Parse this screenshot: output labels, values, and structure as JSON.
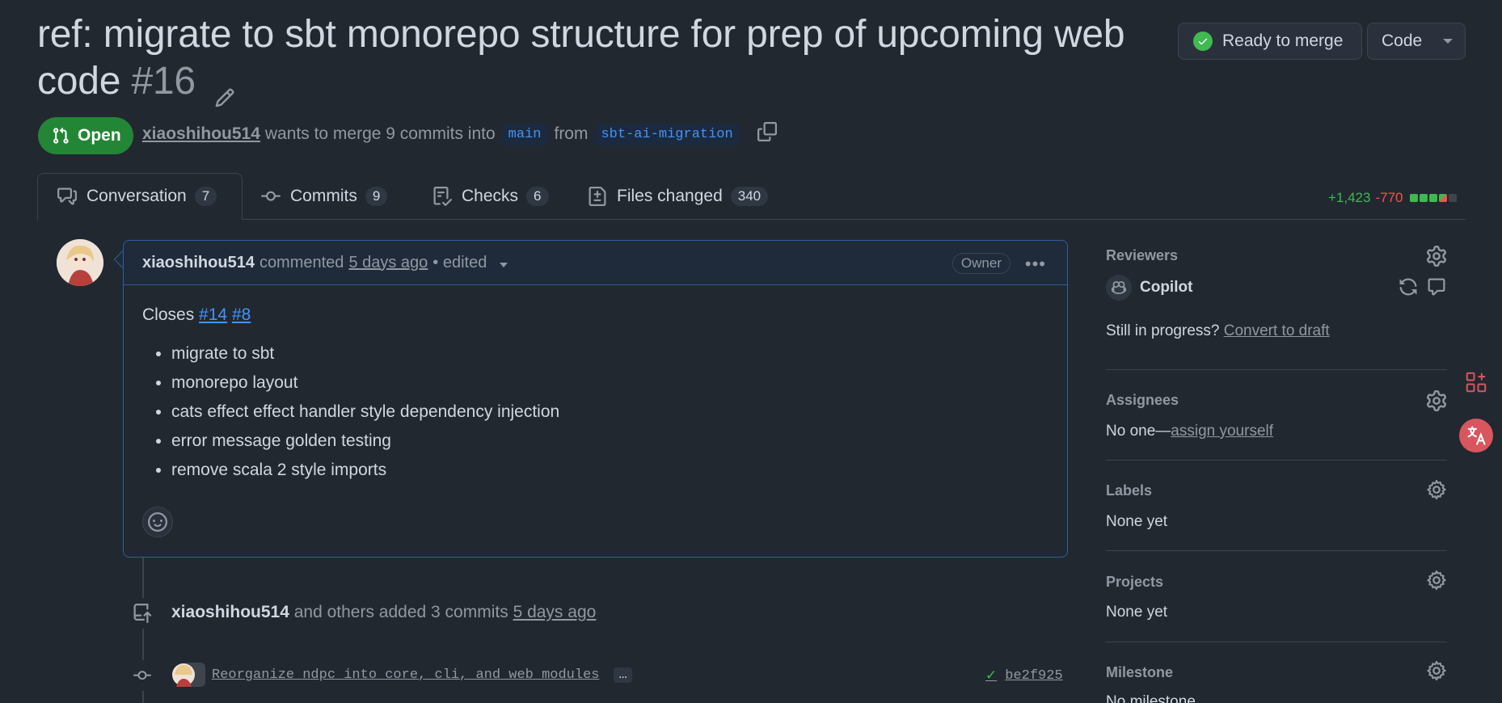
{
  "pr": {
    "title": "ref: migrate to sbt monorepo structure for prep of upcoming web code",
    "number": "#16",
    "status": "Open",
    "author": "xiaoshihou514",
    "merge_text": "wants to merge 9 commits into",
    "base_branch": "main",
    "from_text": "from",
    "head_branch": "sbt-ai-migration"
  },
  "header": {
    "ready_label": "Ready to merge",
    "code_label": "Code"
  },
  "tabs": [
    {
      "label": "Conversation",
      "count": "7"
    },
    {
      "label": "Commits",
      "count": "9"
    },
    {
      "label": "Checks",
      "count": "6"
    },
    {
      "label": "Files changed",
      "count": "340"
    }
  ],
  "diffstat": {
    "additions": "+1,423",
    "deletions": "-770"
  },
  "comment": {
    "author": "xiaoshihou514",
    "verb": "commented",
    "time": "5 days ago",
    "edited": "• edited",
    "role": "Owner",
    "closes_label": "Closes",
    "issues": [
      "#14",
      "#8"
    ],
    "items": [
      "migrate to sbt",
      "monorepo layout",
      "cats effect effect handler style dependency injection",
      "error message golden testing",
      "remove scala 2 style imports"
    ]
  },
  "timeline": {
    "author": "xiaoshihou514",
    "text": "and others added 3 commits",
    "time": "5 days ago",
    "commit_message": "Reorganize ndpc into core, cli, and web modules",
    "commit_more": "…",
    "commit_sha": "be2f925"
  },
  "sidebar": {
    "reviewers_title": "Reviewers",
    "reviewer_name": "Copilot",
    "still_progress": "Still in progress?",
    "convert_draft": "Convert to draft",
    "assignees_title": "Assignees",
    "assignees_prefix": "No one—",
    "assign_yourself": "assign yourself",
    "labels_title": "Labels",
    "labels_value": "None yet",
    "projects_title": "Projects",
    "projects_value": "None yet",
    "milestone_title": "Milestone",
    "milestone_value": "No milestone"
  },
  "colors": {
    "background": "#212830",
    "open_green": "#238636",
    "link_blue": "#4493f8",
    "addition_green": "#3fb950",
    "deletion_red": "#f85149"
  }
}
